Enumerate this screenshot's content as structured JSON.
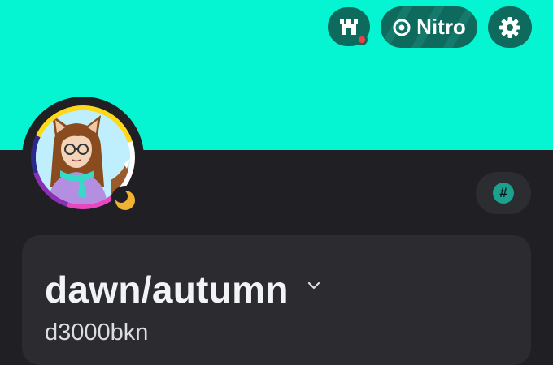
{
  "header": {
    "nitro_label": "Nitro",
    "shop_icon": "shop-icon",
    "nitro_icon": "nitro-icon",
    "settings_icon": "gear-icon"
  },
  "profile": {
    "display_name": "dawn/autumn",
    "username": "d3000bkn",
    "status": "idle",
    "badge_symbol": "#"
  },
  "colors": {
    "banner": "#05f5d3",
    "background": "#1f1f24",
    "card": "#2b2b30",
    "button": "#0e6a5c",
    "status_idle": "#f0b232",
    "notification": "#f23f43"
  }
}
